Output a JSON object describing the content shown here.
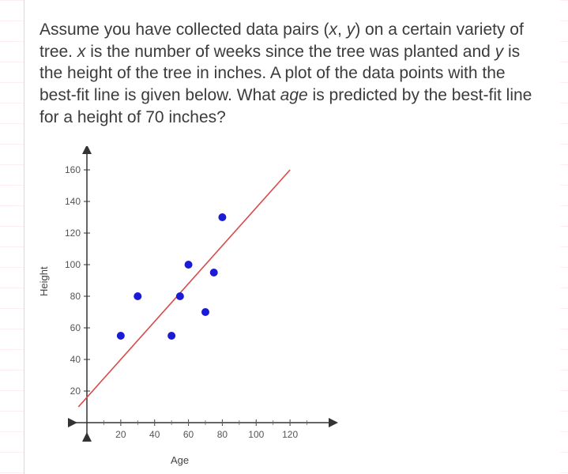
{
  "question_html": "Assume you have collected data pairs (<em>x</em>, <em>y</em>) on a certain variety of tree. <em>x</em> is the number of weeks since the tree was planted and <em>y</em> is the height of the tree in inches. A plot of the data points with the best-fit line is given below. What <em>age</em> is predicted by the best-fit line for a height of 70 inches?",
  "chart_data": {
    "type": "scatter",
    "title": "",
    "xlabel": "Age",
    "ylabel": "Height",
    "xlim": [
      0,
      140
    ],
    "ylim": [
      0,
      170
    ],
    "xticks": [
      20,
      40,
      60,
      80,
      100,
      120
    ],
    "yticks": [
      20,
      40,
      60,
      80,
      100,
      120,
      140,
      160
    ],
    "series": [
      {
        "name": "data-points",
        "type": "scatter",
        "color": "#1b1bd6",
        "points": [
          {
            "x": 20,
            "y": 55
          },
          {
            "x": 30,
            "y": 80
          },
          {
            "x": 50,
            "y": 55
          },
          {
            "x": 55,
            "y": 80
          },
          {
            "x": 60,
            "y": 100
          },
          {
            "x": 70,
            "y": 70
          },
          {
            "x": 75,
            "y": 95
          },
          {
            "x": 80,
            "y": 130
          }
        ]
      },
      {
        "name": "best-fit-line",
        "type": "line",
        "color": "#d84a4a",
        "points": [
          {
            "x": -5,
            "y": 10
          },
          {
            "x": 120,
            "y": 160
          }
        ]
      }
    ]
  }
}
